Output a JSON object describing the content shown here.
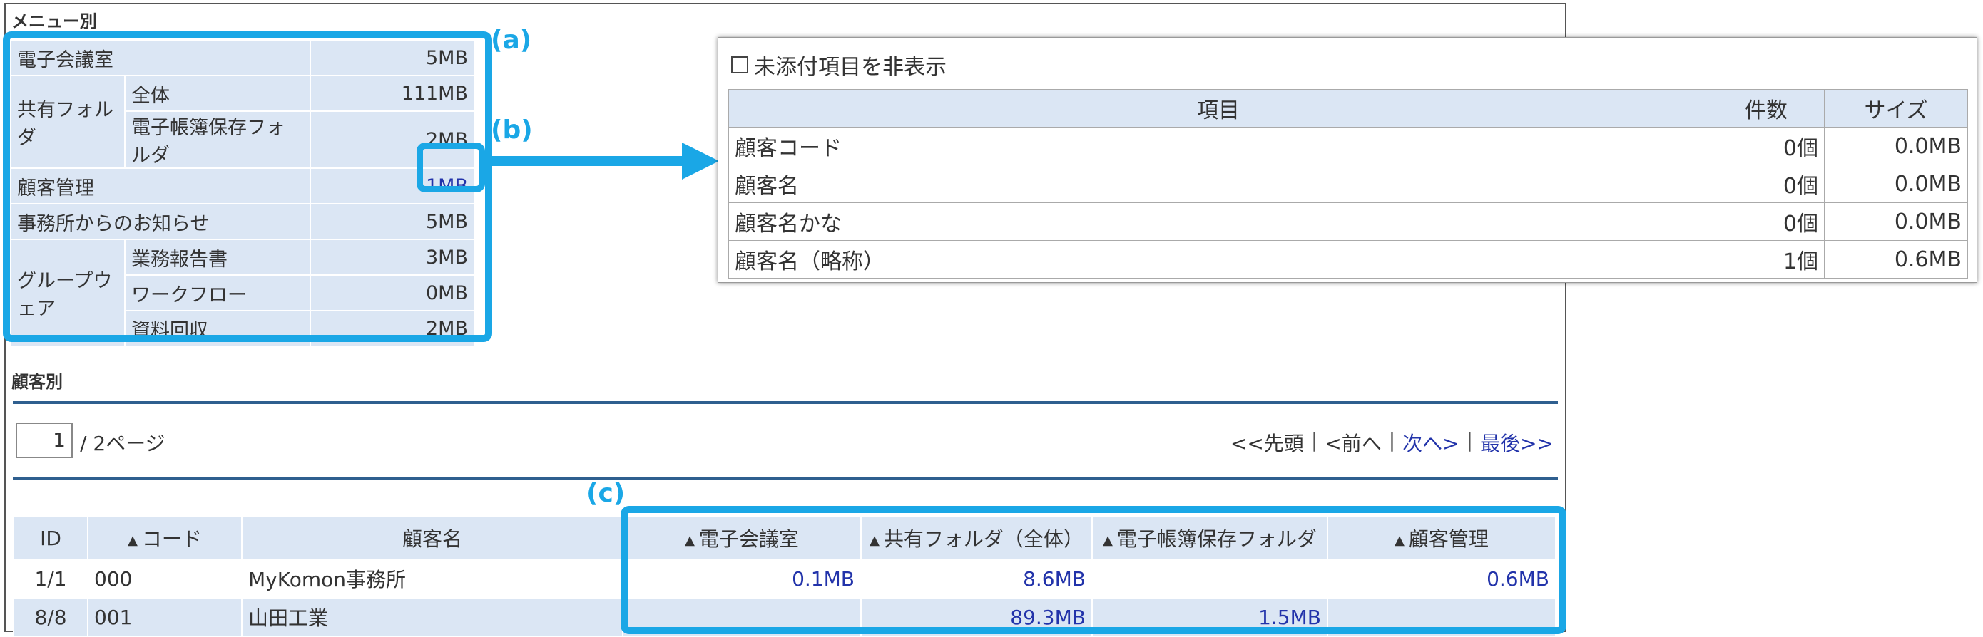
{
  "menu_section": {
    "heading": "メニュー別",
    "rows": [
      {
        "label": "電子会議室",
        "value": "5MB"
      },
      {
        "group": "共有フォルダ",
        "sub": "全体",
        "value": "111MB"
      },
      {
        "sub": "電子帳簿保存フォルダ",
        "value": "2MB"
      },
      {
        "label": "顧客管理",
        "value": "1MB"
      },
      {
        "label": "事務所からのお知らせ",
        "value": "5MB"
      },
      {
        "group": "グループウェア",
        "sub": "業務報告書",
        "value": "3MB"
      },
      {
        "sub": "ワークフロー",
        "value": "0MB"
      },
      {
        "sub": "資料回収",
        "value": "2MB"
      }
    ]
  },
  "callouts": {
    "a": "(a)",
    "b": "(b)",
    "c": "(c)"
  },
  "popup": {
    "checkbox_label": "未添付項目を非表示",
    "headers": [
      "項目",
      "件数",
      "サイズ"
    ],
    "rows": [
      {
        "item": "顧客コード",
        "count": "0個",
        "size": "0.0MB"
      },
      {
        "item": "顧客名",
        "count": "0個",
        "size": "0.0MB"
      },
      {
        "item": "顧客名かな",
        "count": "0個",
        "size": "0.0MB"
      },
      {
        "item": "顧客名（略称）",
        "count": "1個",
        "size": "0.6MB"
      }
    ]
  },
  "customer_section": {
    "heading": "顧客別",
    "pager": {
      "page": "1",
      "total": "/ 2ページ",
      "first": "<<先頭",
      "prev": "<前へ",
      "next": "次へ>",
      "last": "最後>>",
      "sep": "|"
    },
    "headers": [
      "ID",
      "コード",
      "顧客名",
      "電子会議室",
      "共有フォルダ（全体）",
      "電子帳簿保存フォルダ",
      "顧客管理"
    ],
    "sort_icon": "▲",
    "rows": [
      {
        "id": "1/1",
        "code": "000",
        "name": "MyKomon事務所",
        "meeting": "0.1MB",
        "shared": "8.6MB",
        "ebook": "",
        "customer": "0.6MB"
      },
      {
        "id": "8/8",
        "code": "001",
        "name": "山田工業",
        "meeting": "",
        "shared": "89.3MB",
        "ebook": "1.5MB",
        "customer": ""
      }
    ]
  },
  "colors": {
    "accent": "#1aa7e6",
    "cell_bg": "#dbe6f4",
    "link": "#2233aa"
  }
}
